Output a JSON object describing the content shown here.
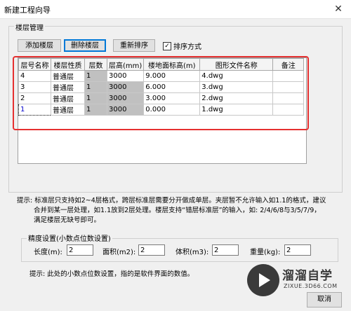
{
  "window": {
    "title": "新建工程向导",
    "close_symbol": "✕"
  },
  "floors_group": {
    "label": "楼层管理",
    "add_label": "添加楼层",
    "delete_label": "删除楼层",
    "reorder_label": "重新排序",
    "sort_checkbox_label": "排序方式",
    "sort_checked": true
  },
  "table": {
    "headers": [
      "层号名称",
      "楼层性质",
      "层数",
      "层高(mm)",
      "楼地面标高(m)",
      "图形文件名称",
      "备注"
    ],
    "rows": [
      [
        "4",
        "普通层",
        "1",
        "3000",
        "9.000",
        "4.dwg",
        ""
      ],
      [
        "3",
        "普通层",
        "1",
        "3000",
        "6.000",
        "3.dwg",
        ""
      ],
      [
        "2",
        "普通层",
        "1",
        "3000",
        "3.000",
        "2.dwg",
        ""
      ],
      [
        "1",
        "普通层",
        "1",
        "3000",
        "0.000",
        "1.dwg",
        ""
      ]
    ]
  },
  "hint1": {
    "line1": "提示: 标准层只支持如2~4层格式，跨层标准层需要分开做成单层。夹层暂不允许输入如1.1的格式，建议",
    "line2": "合并到某一层处理，如1.1放到2层处理。楼层支持“错层标准层”的输入，如: 2/4/6/8与3/5/7/9，",
    "line3": "满足楼层无缺号即可。"
  },
  "precision_group": {
    "label": "精度设置(小数点位数设置)",
    "length_label": "长度(m):",
    "length_value": "2",
    "area_label": "面积(m2):",
    "area_value": "2",
    "volume_label": "体积(m3):",
    "volume_value": "2",
    "weight_label": "重量(kg):",
    "weight_value": "2"
  },
  "hint2": "提示: 此处的小数点位数设置，指的是软件界面的数值。",
  "watermark": {
    "brand": "溜溜自学",
    "url": "ZIXUE.3D66.COM"
  },
  "cancel_label": "取消"
}
